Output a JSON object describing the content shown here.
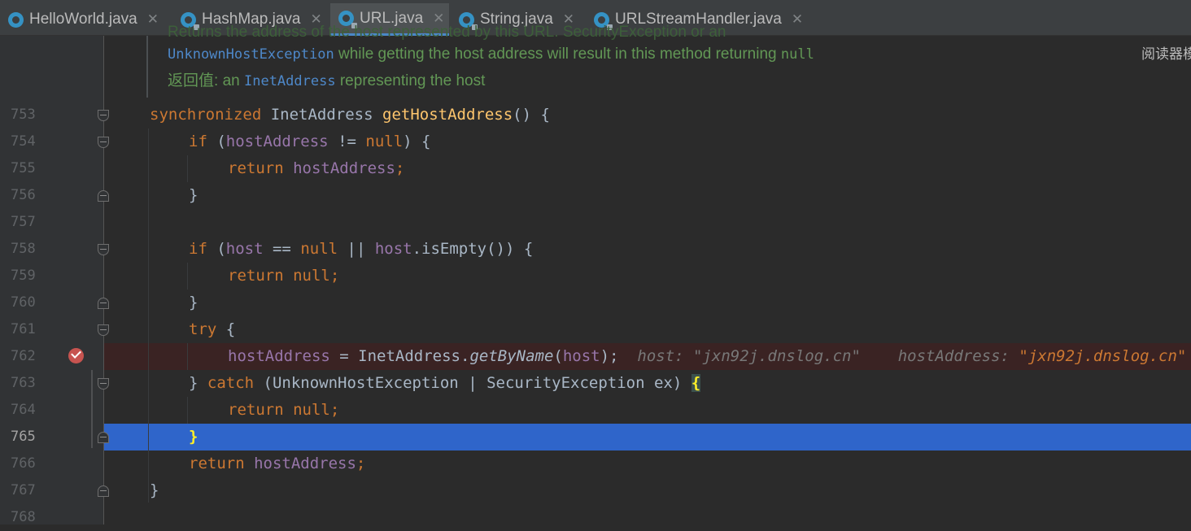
{
  "tabs": [
    {
      "label": "HelloWorld.java",
      "active": false
    },
    {
      "label": "HashMap.java",
      "active": false
    },
    {
      "label": "URL.java",
      "active": true
    },
    {
      "label": "String.java",
      "active": false
    },
    {
      "label": "URLStreamHandler.java",
      "active": false
    }
  ],
  "close_glyph": "✕",
  "reader_mode": "阅读器模式",
  "doc": {
    "line0": "Returns the address of the host represented by this URL. SecurityException or an",
    "line1_a": "UnknownHostException",
    "line1_b": " while getting the host address will result in this method returning ",
    "line1_c": "null",
    "line2_a": "返回值: ",
    "line2_b": "an ",
    "line2_c": "InetAddress",
    "line2_d": " representing the host"
  },
  "line_numbers": [
    "753",
    "754",
    "755",
    "756",
    "757",
    "758",
    "759",
    "760",
    "761",
    "762",
    "763",
    "764",
    "765",
    "766",
    "767",
    "768"
  ],
  "current_line": "765",
  "code": {
    "l753": {
      "kw": "synchronized ",
      "type": "InetAddress ",
      "method": "getHostAddress",
      "rest": "() {"
    },
    "l754": {
      "kw": "if ",
      "p1": "(",
      "fld": "hostAddress",
      "op": " != ",
      "kw2": "null",
      "rest": ") {"
    },
    "l755": {
      "kw": "return ",
      "fld": "hostAddress",
      "rest": ";"
    },
    "l756": "}",
    "l758": {
      "kw": "if ",
      "p1": "(",
      "fld": "host",
      "op": " == ",
      "kw2": "null",
      "op2": " || ",
      "fld2": "host",
      "rest": ".isEmpty()) {"
    },
    "l759": {
      "kw": "return ",
      "kw2": "null",
      "rest": ";"
    },
    "l760": "}",
    "l761": {
      "kw": "try",
      "rest": " {"
    },
    "l762": {
      "fld": "hostAddress",
      "op": " = InetAddress.",
      "stat": "getByName",
      "p1": "(",
      "fld2": "host",
      "rest": ");",
      "inlay1_name": "host: ",
      "inlay1_val": "\"jxn92j.dnslog.cn\"",
      "inlay2_name": "hostAddress: ",
      "inlay2_val": "\"jxn92j.dnslog.cn\""
    },
    "l763": {
      "p1": "} ",
      "kw": "catch",
      "rest": " (UnknownHostException | SecurityException ex) ",
      "brace": "{"
    },
    "l764": {
      "kw": "return ",
      "kw2": "null",
      "rest": ";"
    },
    "l765": {
      "brace": "}"
    },
    "l766": {
      "kw": "return ",
      "fld": "hostAddress",
      "rest": ";"
    },
    "l767": "}"
  },
  "colors": {
    "background": "#2b2b2b",
    "gutter": "#313335",
    "keyword": "#cc7832",
    "field": "#9876aa",
    "method": "#ffc66d",
    "doc_text": "#629755",
    "doc_link": "#287bde",
    "current_line": "#2f65ca",
    "breakpoint_line": "#3a2323",
    "breakpoint": "#c75450"
  },
  "icons": {
    "tab_icon": "java-class-icon",
    "breakpoint_icon": "breakpoint-verified-icon",
    "fold_icon": "fold-marker-icon"
  }
}
